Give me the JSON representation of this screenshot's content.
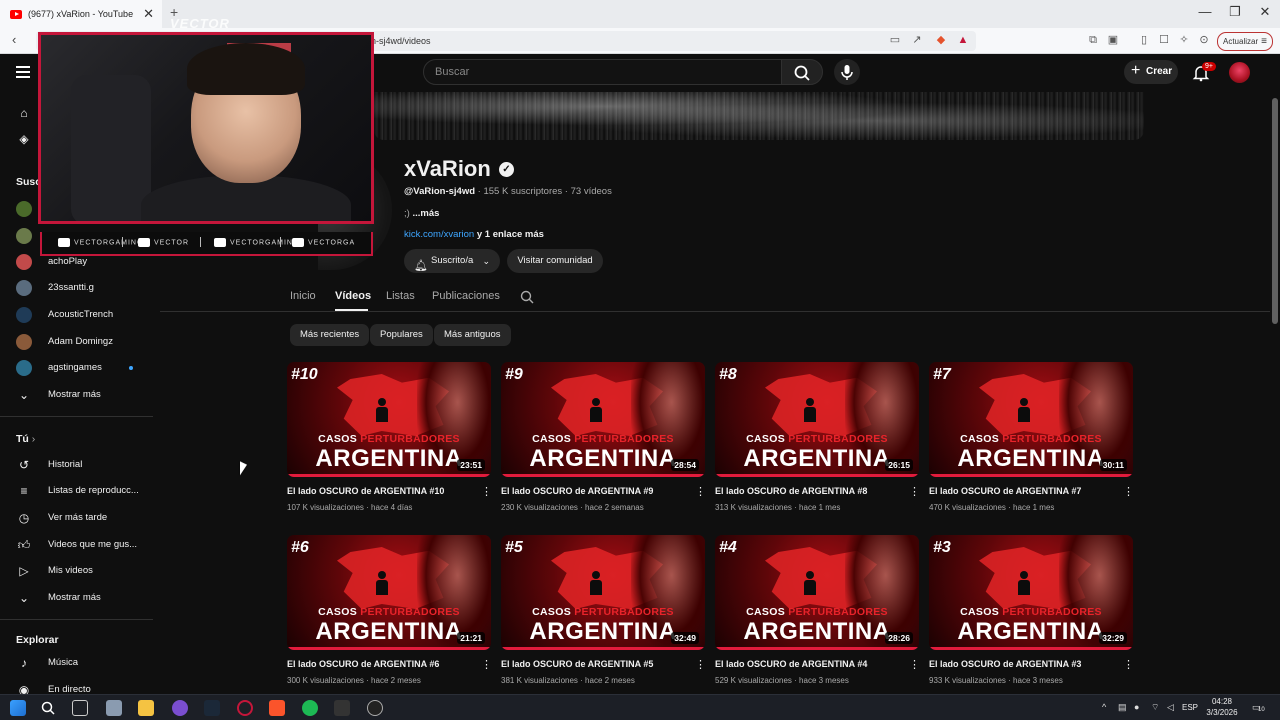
{
  "browser": {
    "tab_title": "(9677) xVaRion - YouTube",
    "url_fragment": "n-sj4wd/videos",
    "update_label": "Actualizar",
    "tab_close": "✕",
    "new_tab": "+",
    "minimize": "—",
    "restore": "❐",
    "close": "✕"
  },
  "header": {
    "search_placeholder": "Buscar",
    "create_label": "Crear",
    "notifications_badge": "9+"
  },
  "sidebar": {
    "subscriptions_title": "Susc",
    "subscriptions": [
      {
        "name": "achoPlay",
        "color": "#c24a4a"
      },
      {
        "name": "23ssantti.g",
        "color": "#5a6c7e"
      },
      {
        "name": "AcousticTrench",
        "color": "#1f3b57"
      },
      {
        "name": "Adam Domingz",
        "color": "#8a5a3a"
      },
      {
        "name": "agstingames",
        "color": "#2a6c8a"
      }
    ],
    "show_more_1": "Mostrar más",
    "you_title": "Tú",
    "you_items": [
      "Historial",
      "Listas de reproducc...",
      "Ver más tarde",
      "Videos que me gus...",
      "Mis videos"
    ],
    "show_more_2": "Mostrar más",
    "explore_title": "Explorar",
    "explore_items": [
      "Música",
      "En directo"
    ]
  },
  "overlay": {
    "logo_text": "VECTOR",
    "social": [
      "VECTORGAMING",
      "VECTOR",
      "VECTORGAMING",
      "VECTORGA"
    ]
  },
  "channel": {
    "name": "xVaRion",
    "handle": "@VaRion-sj4wd",
    "subscribers": "155 K suscriptores",
    "videos_count": "73 vídeos",
    "description": ";)",
    "more": "...más",
    "link": "kick.com/xvarion",
    "link_more": "y 1 enlace más",
    "subscribed_label": "Suscrito/a",
    "community_label": "Visitar comunidad",
    "tabs": [
      "Inicio",
      "Vídeos",
      "Listas",
      "Publicaciones"
    ],
    "chips": [
      "Más recientes",
      "Populares",
      "Más antiguos"
    ]
  },
  "videos": [
    {
      "num": "#10",
      "duration": "23:51",
      "title": "El lado OSCURO de ARGENTINA #10",
      "views": "107 K visualizaciones",
      "age": "hace 4 días"
    },
    {
      "num": "#9",
      "duration": "28:54",
      "title": "El lado OSCURO de ARGENTINA #9",
      "views": "230 K visualizaciones",
      "age": "hace 2 semanas"
    },
    {
      "num": "#8",
      "duration": "26:15",
      "title": "El lado OSCURO de ARGENTINA #8",
      "views": "313 K visualizaciones",
      "age": "hace 1 mes"
    },
    {
      "num": "#7",
      "duration": "30:11",
      "title": "El lado OSCURO de ARGENTINA #7",
      "views": "470 K visualizaciones",
      "age": "hace 1 mes"
    },
    {
      "num": "#6",
      "duration": "21:21",
      "title": "El lado OSCURO de ARGENTINA #6",
      "views": "300 K visualizaciones",
      "age": "hace 2 meses"
    },
    {
      "num": "#5",
      "duration": "32:49",
      "title": "El lado OSCURO de ARGENTINA #5",
      "views": "381 K visualizaciones",
      "age": "hace 2 meses"
    },
    {
      "num": "#4",
      "duration": "28:26",
      "title": "El lado OSCURO de ARGENTINA #4",
      "views": "529 K visualizaciones",
      "age": "hace 3 meses"
    },
    {
      "num": "#3",
      "duration": "32:29",
      "title": "El lado OSCURO de ARGENTINA #3",
      "views": "933 K visualizaciones",
      "age": "hace 3 meses"
    }
  ],
  "thumbnail_text": {
    "casos": "CASOS",
    "perturbadores": "PERTURBADORES",
    "argentina": "ARGENTINA"
  },
  "taskbar": {
    "language": "ESP",
    "time": "04:28",
    "date": "3/3/2026",
    "notif_count": "10"
  },
  "colors": {
    "accent_red": "#cc0000",
    "link_blue": "#3ea6ff",
    "webcam_border": "#c4163a"
  }
}
